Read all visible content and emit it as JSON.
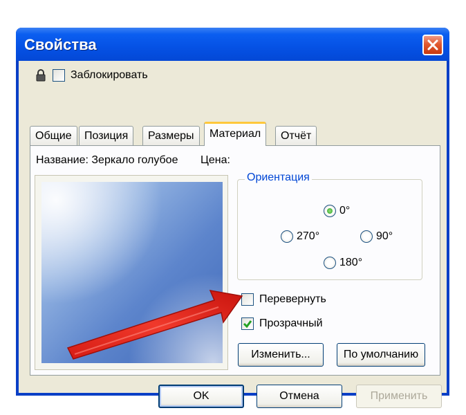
{
  "window": {
    "title": "Свойства"
  },
  "lock": {
    "label": "Заблокировать",
    "checked": false
  },
  "tabs": [
    {
      "label": "Общие",
      "active": false
    },
    {
      "label": "Позиция",
      "active": false
    },
    {
      "label": "Размеры",
      "active": false
    },
    {
      "label": "Материал",
      "active": true
    },
    {
      "label": "Отчёт",
      "active": false
    }
  ],
  "material": {
    "name_label": "Название: Зеркало голубое",
    "price_label": "Цена:",
    "orientation": {
      "title": "Ориентация",
      "options": [
        "0°",
        "270°",
        "90°",
        "180°"
      ],
      "selected": "0°"
    },
    "flip": {
      "label": "Перевернуть",
      "checked": false
    },
    "transparent": {
      "label": "Прозрачный",
      "checked": true
    },
    "change_button": "Изменить...",
    "default_button": "По умолчанию"
  },
  "buttons": {
    "ok": "OK",
    "cancel": "Отмена",
    "apply": "Применить"
  },
  "colors": {
    "titlebar": "#0551e4",
    "dialog_bg": "#ece9d8",
    "accent_arrow": "#e8251c",
    "check_green": "#21a121"
  },
  "icons": {
    "close": "close-icon",
    "lock": "lock-icon",
    "check": "checkmark-icon"
  }
}
